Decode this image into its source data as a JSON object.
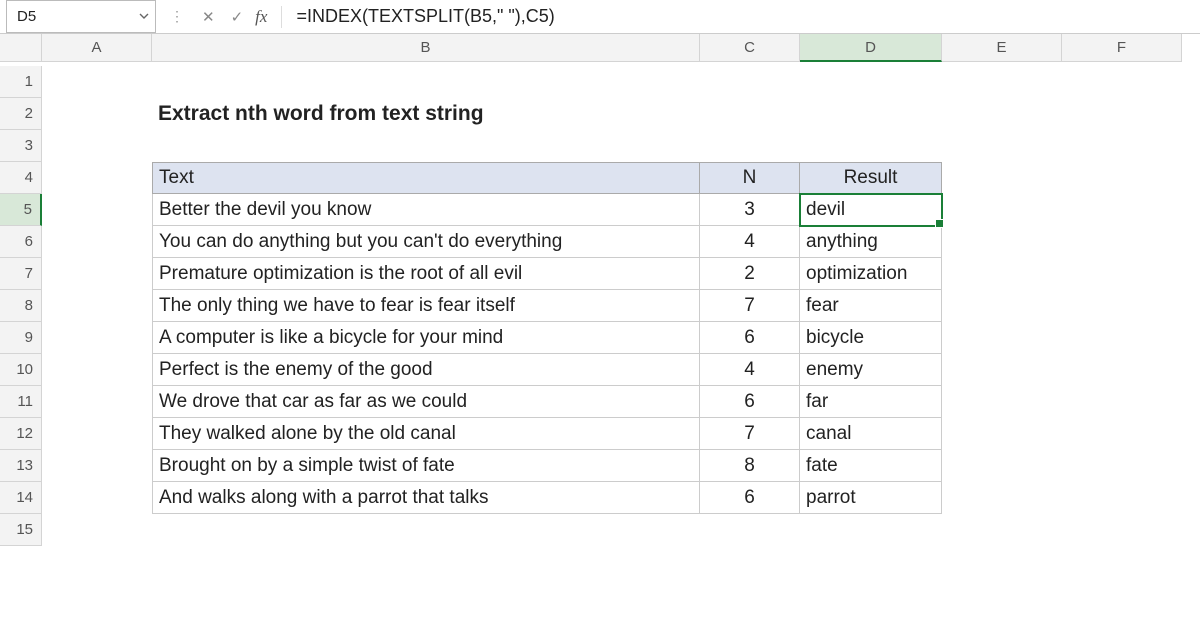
{
  "nameBox": "D5",
  "formula": "=INDEX(TEXTSPLIT(B5,\" \"),C5)",
  "columns": [
    "A",
    "B",
    "C",
    "D",
    "E",
    "F"
  ],
  "rowCount": 15,
  "selectedCell": {
    "col": "D",
    "row": 5
  },
  "title": "Extract nth word from text string",
  "titleCell": "B2",
  "headerRow": 4,
  "dataStartRow": 5,
  "headers": {
    "text": "Text",
    "n": "N",
    "result": "Result"
  },
  "rows": [
    {
      "text": "Better the devil you know",
      "n": 3,
      "result": "devil"
    },
    {
      "text": "You can do anything but you can't do everything",
      "n": 4,
      "result": "anything"
    },
    {
      "text": "Premature optimization is the root of all evil",
      "n": 2,
      "result": "optimization"
    },
    {
      "text": "The only thing we have to fear is fear itself",
      "n": 7,
      "result": "fear"
    },
    {
      "text": "A computer is like a bicycle for your mind",
      "n": 6,
      "result": "bicycle"
    },
    {
      "text": "Perfect is the enemy of the good",
      "n": 4,
      "result": "enemy"
    },
    {
      "text": "We drove that car as far as we could",
      "n": 6,
      "result": "far"
    },
    {
      "text": "They walked alone by the old canal",
      "n": 7,
      "result": "canal"
    },
    {
      "text": "Brought on by a simple twist of fate",
      "n": 8,
      "result": "fate"
    },
    {
      "text": "And walks along with a parrot that talks",
      "n": 6,
      "result": "parrot"
    }
  ],
  "icons": {
    "cancel": "✕",
    "confirm": "✓",
    "fx": "fx",
    "sep": "⋮"
  }
}
